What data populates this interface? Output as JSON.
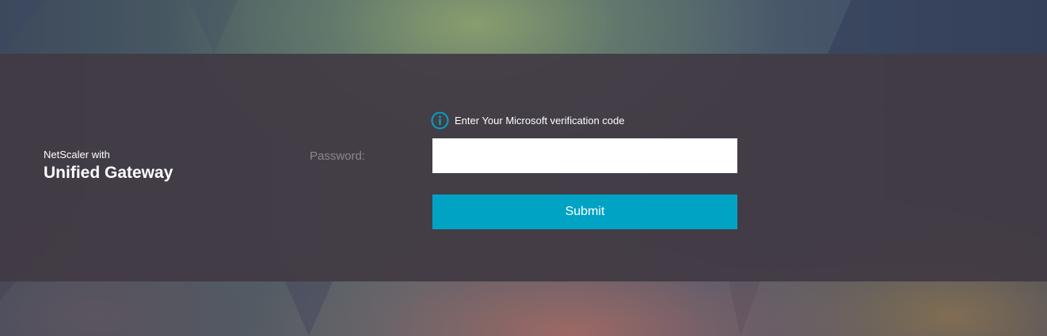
{
  "brand": {
    "line1": "NetScaler with",
    "line2": "Unified Gateway"
  },
  "form": {
    "info_text": "Enter Your Microsoft verification code",
    "info_icon": "info-icon",
    "password_label": "Password:",
    "password_value": "",
    "password_placeholder": "",
    "submit_label": "Submit"
  },
  "colors": {
    "accent": "#00a3c4",
    "band": "#423a44",
    "label_muted": "#8b8890"
  }
}
